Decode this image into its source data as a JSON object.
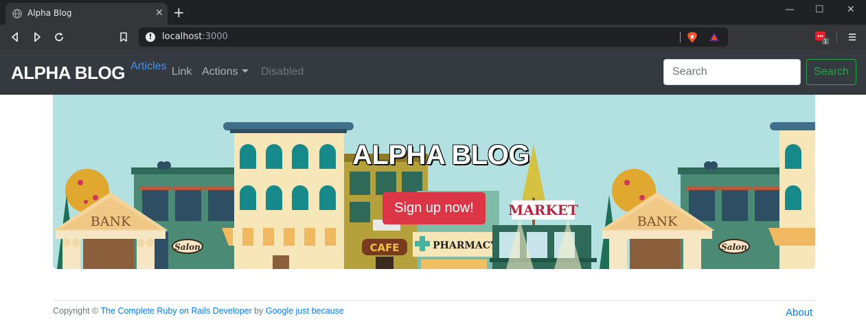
{
  "browser": {
    "tab_title": "Alpha Blog",
    "tab_close": "✕",
    "new_tab": "+",
    "window_minimize": "—",
    "window_maximize": "☐",
    "window_close": "✕",
    "url_host": "localhost",
    "url_port": ":3000",
    "info_glyph": "!",
    "extension_badge": "1"
  },
  "navbar": {
    "brand": "ALPHA BLOG",
    "articles": "Articles",
    "link": "Link",
    "actions": "Actions",
    "disabled": "Disabled",
    "search_placeholder": "Search",
    "search_button": "Search"
  },
  "hero": {
    "title": "ALPHA BLOG",
    "signup_button": "Sign up now!",
    "sign_bank": "BANK",
    "sign_salon": "Salon",
    "sign_cafe": "CAFE",
    "sign_pharmacy": "PHARMACY",
    "sign_market": "MARKET"
  },
  "footer": {
    "copyright": "Copyright ©",
    "course_link": "The Complete Ruby on Rails Developer",
    "by": "by",
    "google_link": "Google just because",
    "about": "About"
  },
  "colors": {
    "navbar_bg": "#343a40",
    "signup_bg": "#dc3545",
    "search_btn": "#28a745",
    "link_blue": "#007bff",
    "sky": "#b3e0e0"
  },
  "icons": [
    "globe-icon",
    "close-icon",
    "plus-icon",
    "back-icon",
    "forward-icon",
    "reload-icon",
    "bookmark-icon",
    "info-icon",
    "brave-shield-icon",
    "bat-rewards-icon",
    "extension-icon",
    "menu-icon",
    "caret-down-icon"
  ]
}
